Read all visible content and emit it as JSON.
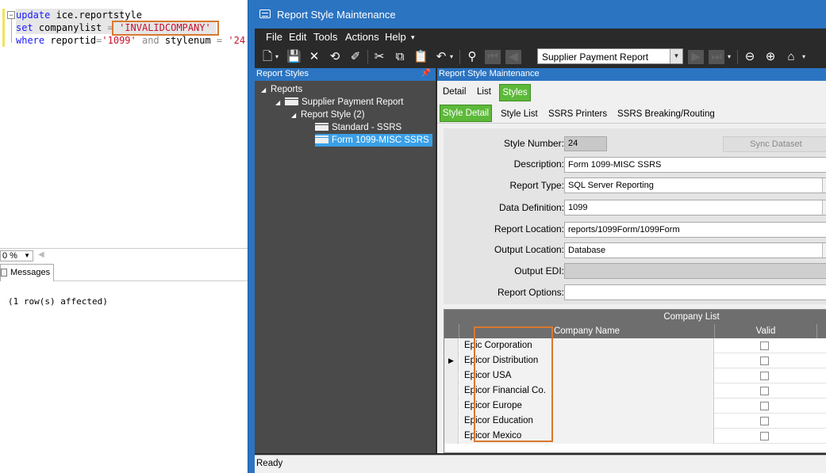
{
  "sql": {
    "line1_kw": "update",
    "line1_rest": " ice.reportstyle",
    "line2_kw": "set",
    "line2_mid": " companylist ",
    "line2_eq": "=",
    "line2_str": "'INVALIDCOMPANY'",
    "line3_kw": "where",
    "line3_mid": " reportid",
    "line3_eq": "=",
    "line3_str": "'1099'",
    "line3_and": " and ",
    "line3_mid2": "stylenum ",
    "line3_eq2": "=",
    "line3_str2": " '24'",
    "fold_glyph": "−"
  },
  "results": {
    "zoom": "0 %",
    "messages_tab": "Messages",
    "messages_text": "(1 row(s) affected)"
  },
  "window": {
    "title": "Report Style Maintenance"
  },
  "menu": {
    "file": "File",
    "edit": "Edit",
    "tools": "Tools",
    "actions": "Actions",
    "help": "Help"
  },
  "toolbar": {
    "report_selector": "Supplier Payment Report"
  },
  "tree": {
    "header": "Report Styles",
    "nodes": [
      {
        "label": "Reports"
      },
      {
        "label": "Supplier Payment Report"
      },
      {
        "label": "Report Style (2)"
      },
      {
        "label": "Standard - SSRS"
      },
      {
        "label": "Form 1099-MISC SSRS"
      }
    ]
  },
  "main": {
    "header": "Report Style Maintenance",
    "tabs": [
      "Detail",
      "List",
      "Styles"
    ],
    "subtabs": [
      "Style Detail",
      "Style List",
      "SSRS Printers",
      "SSRS Breaking/Routing"
    ],
    "sync_label": "Sync Dataset",
    "fields": {
      "style_number_label": "Style Number:",
      "style_number": "24",
      "description_label": "Description:",
      "description": "Form 1099-MISC SSRS",
      "report_type_label": "Report Type:",
      "report_type": "SQL Server Reporting",
      "data_definition_label": "Data Definition:",
      "data_definition": "1099",
      "report_location_label": "Report Location:",
      "report_location": "reports/1099Form/1099Form",
      "output_location_label": "Output Location:",
      "output_location": "Database",
      "output_edi_label": "Output EDI:",
      "output_edi": "",
      "report_options_label": "Report Options:",
      "report_options": ""
    }
  },
  "company_grid": {
    "title": "Company List",
    "col_name": "Company Name",
    "col_valid": "Valid",
    "rows": [
      {
        "name": "Epic Corporation",
        "valid": false
      },
      {
        "name": "Epicor Distribution",
        "valid": false
      },
      {
        "name": "Epicor USA",
        "valid": false
      },
      {
        "name": "Epicor Financial Co.",
        "valid": false
      },
      {
        "name": "Epicor Europe",
        "valid": false
      },
      {
        "name": "Epicor Education",
        "valid": false
      },
      {
        "name": "Epicor Mexico",
        "valid": false
      }
    ]
  },
  "status": {
    "text": "Ready"
  },
  "colors": {
    "accent_blue": "#2b74c2",
    "tab_green": "#5db93a",
    "callout_orange": "#d9782e",
    "tree_selected": "#3aa0e8"
  }
}
